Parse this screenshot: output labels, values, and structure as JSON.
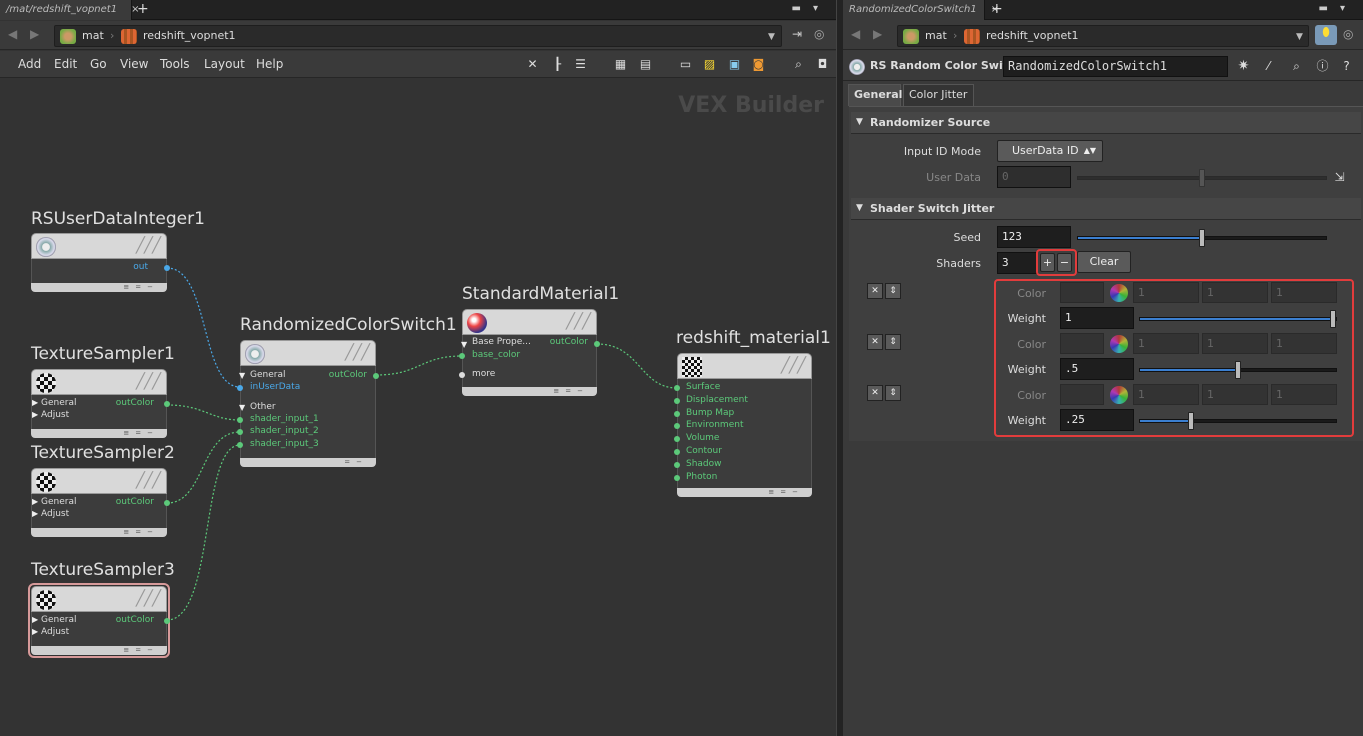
{
  "left_pane": {
    "tab_title": "/mat/redshift_vopnet1",
    "tab_close": "×",
    "tab_add": "+",
    "path": [
      "mat",
      "redshift_vopnet1"
    ],
    "menu": [
      "Add",
      "Edit",
      "Go",
      "View",
      "Tools",
      "Layout",
      "Help"
    ],
    "watermark": "VEX Builder"
  },
  "nodes": {
    "rsuserdata": {
      "title": "RSUserDataInteger1",
      "out": "out"
    },
    "tex1": {
      "title": "TextureSampler1",
      "general": "General",
      "adjust": "Adjust",
      "out": "outColor"
    },
    "tex2": {
      "title": "TextureSampler2",
      "general": "General",
      "adjust": "Adjust",
      "out": "outColor"
    },
    "tex3": {
      "title": "TextureSampler3",
      "general": "General",
      "adjust": "Adjust",
      "out": "outColor"
    },
    "switch": {
      "title": "RandomizedColorSwitch1",
      "general": "General",
      "in_user": "inUserData",
      "out": "outColor",
      "other": "Other",
      "inputs": [
        "shader_input_1",
        "shader_input_2",
        "shader_input_3"
      ]
    },
    "std": {
      "title": "StandardMaterial1",
      "base": "Base Prope...",
      "out": "outColor",
      "base_color": "base_color",
      "more": "more"
    },
    "rsmat": {
      "title": "redshift_material1",
      "inputs": [
        "Surface",
        "Displacement",
        "Bump Map",
        "Environment",
        "Volume",
        "Contour",
        "Shadow",
        "Photon"
      ]
    }
  },
  "right_pane": {
    "tab_title": "RandomizedColorSwitch1",
    "tab_close": "×",
    "tab_add": "+",
    "path": [
      "mat",
      "redshift_vopnet1"
    ],
    "op_type": "RS Random Color Switch",
    "op_name": "RandomizedColorSwitch1",
    "tabs": [
      "General",
      "Color Jitter"
    ],
    "sections": {
      "randomizer": "Randomizer Source",
      "jitter": "Shader Switch Jitter"
    },
    "params": {
      "input_id_mode_label": "Input ID Mode",
      "input_id_mode_value": "UserData ID",
      "user_data_label": "User Data",
      "user_data_value": "0",
      "seed_label": "Seed",
      "seed_value": "123",
      "shaders_label": "Shaders",
      "shaders_value": "3",
      "plus": "+",
      "minus": "−",
      "clear": "Clear"
    },
    "shader_entries": [
      {
        "color_label": "Color",
        "c": [
          "1",
          "1",
          "1"
        ],
        "weight_label": "Weight",
        "weight": "1",
        "weight_fraction": 1.0
      },
      {
        "color_label": "Color",
        "c": [
          "1",
          "1",
          "1"
        ],
        "weight_label": "Weight",
        "weight": ".5",
        "weight_fraction": 0.5
      },
      {
        "color_label": "Color",
        "c": [
          "1",
          "1",
          "1"
        ],
        "weight_label": "Weight",
        "weight": ".25",
        "weight_fraction": 0.25
      }
    ],
    "seed_fraction": 0.5
  }
}
